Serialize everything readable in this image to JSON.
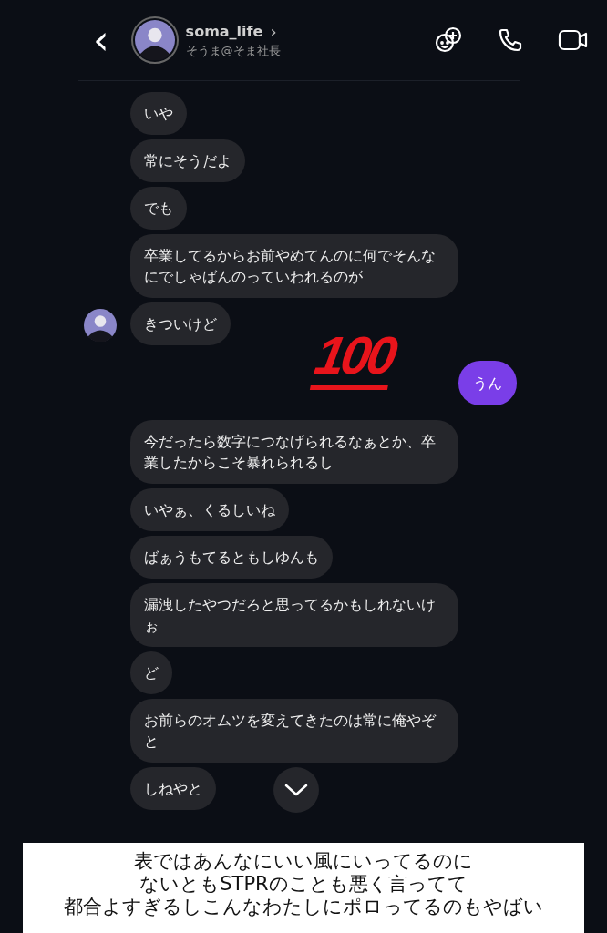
{
  "header": {
    "back": "‹",
    "username": "soma_life",
    "chevron": "›",
    "subtitle": "そうま@そま社長"
  },
  "messages": [
    {
      "kind": "received",
      "text": "いや",
      "avatar": false
    },
    {
      "kind": "received",
      "text": "常にそうだよ",
      "avatar": false
    },
    {
      "kind": "received",
      "text": "でも",
      "avatar": false
    },
    {
      "kind": "received",
      "text": "卒業してるからお前やめてんのに何でそんなにでしゃばんのっていわれるのが",
      "avatar": false
    },
    {
      "kind": "received",
      "text": "きついけど",
      "avatar": true
    },
    {
      "kind": "sent",
      "text": "うん"
    },
    {
      "kind": "received",
      "text": "今だったら数字につなげられるなぁとか、卒業したからこそ暴れられるし",
      "avatar": false
    },
    {
      "kind": "received",
      "text": "いやぁ、くるしいね",
      "avatar": false
    },
    {
      "kind": "received",
      "text": "ばぁうもてるともしゆんも",
      "avatar": false
    },
    {
      "kind": "received",
      "text": "漏洩したやつだろと思ってるかもしれないけぉ",
      "avatar": false
    },
    {
      "kind": "received",
      "text": "ど",
      "avatar": false
    },
    {
      "kind": "received",
      "text": "お前らのオムツを変えてきたのは常に俺やぞと",
      "avatar": false
    },
    {
      "kind": "received",
      "text": "しねやと",
      "avatar": false
    }
  ],
  "sticker": {
    "text": "100"
  },
  "caption": [
    "表ではあんなにいい風にいってるのに",
    "ないともSTPRのことも悪く言ってて",
    "都合よすぎるしこんなわたしにポロってるのもやばい"
  ]
}
